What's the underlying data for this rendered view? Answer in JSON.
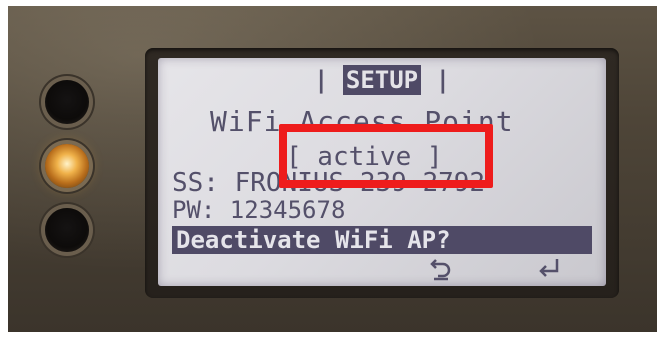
{
  "display": {
    "title_bar_left": "|",
    "title": "SETUP",
    "title_bar_right": "|",
    "heading": "WiFi Access Point",
    "status": "[ active ]",
    "ssid": "SS: FRONIUS 239 2792",
    "password": "PW: 12345678",
    "prompt": "Deactivate WiFi AP?"
  },
  "softkeys": {
    "back_icon": "undo-arrow-icon",
    "enter_icon": "enter-return-icon"
  },
  "annotation": {
    "highlight_color": "#ee1c1c"
  },
  "colors": {
    "lcd_text": "#54506a",
    "lcd_background": "#dcdbe0",
    "inverted_bar": "#4f4a66",
    "led_active": "#f0b24a"
  }
}
